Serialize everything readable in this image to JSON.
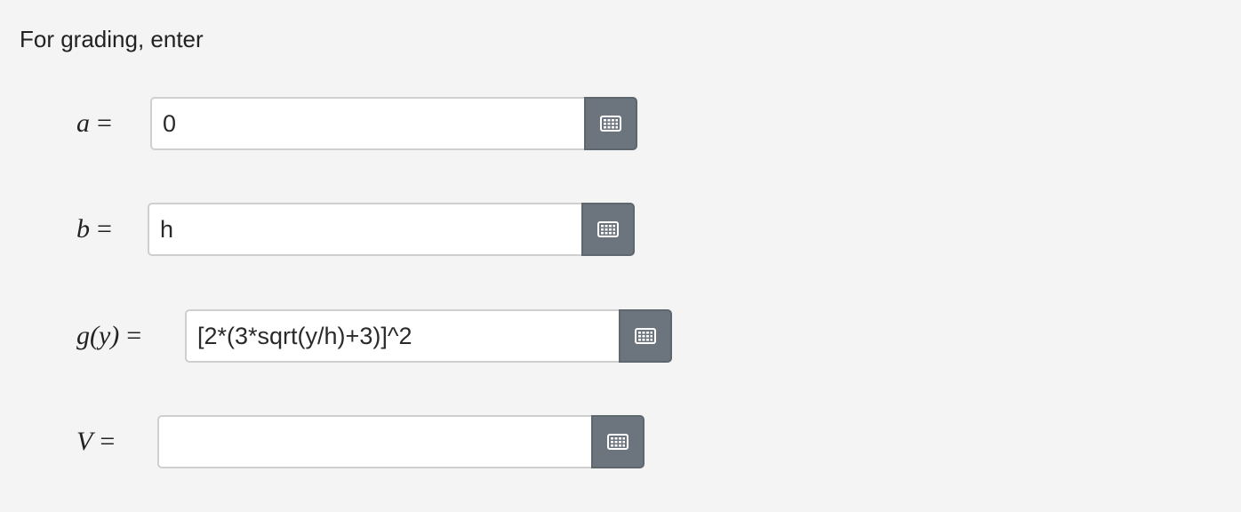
{
  "prompt": "For grading, enter",
  "fields": [
    {
      "var": "a",
      "equals": "=",
      "value": "0",
      "placeholder": ""
    },
    {
      "var": "b",
      "equals": "=",
      "value": "h",
      "placeholder": ""
    },
    {
      "var": "g(y)",
      "equals": "=",
      "value": "[2*(3*sqrt(y/h)+3)]^2",
      "placeholder": ""
    },
    {
      "var": "V",
      "equals": "=",
      "value": "",
      "placeholder": ""
    }
  ],
  "icons": {
    "keyboard_button": "keyboard-grid-icon"
  },
  "colors": {
    "background": "#f4f4f4",
    "button": "#6c757d",
    "input_border": "#cfcfcf"
  }
}
